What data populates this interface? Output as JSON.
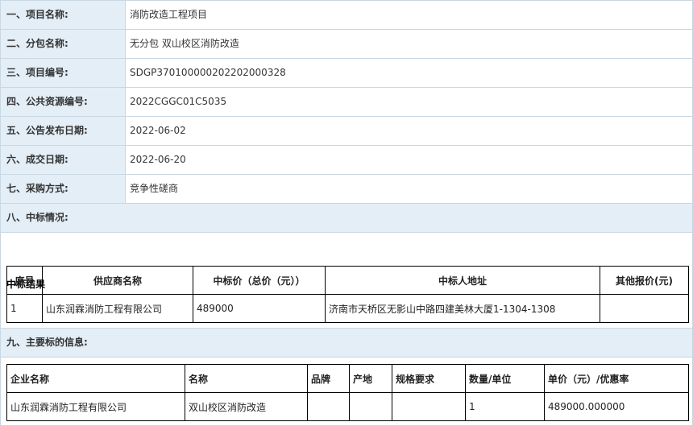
{
  "fields": [
    {
      "label": "一、项目名称:",
      "value": "消防改造工程项目"
    },
    {
      "label": "二、分包名称:",
      "value": "无分包 双山校区消防改造"
    },
    {
      "label": "三、项目编号:",
      "value": "SDGP370100000202202000328"
    },
    {
      "label": "四、公共资源编号:",
      "value": "2022CGGC01C5035"
    },
    {
      "label": "五、公告发布日期:",
      "value": "2022-06-02"
    },
    {
      "label": "六、成交日期:",
      "value": "2022-06-20"
    },
    {
      "label": "七、采购方式:",
      "value": "竞争性磋商"
    }
  ],
  "section8": {
    "label": "八、中标情况:",
    "subtitle": "中标结果",
    "headers": [
      "序号",
      "供应商名称",
      "中标价（总价（元））",
      "中标人地址",
      "其他报价(元)"
    ],
    "rows": [
      [
        "1",
        "山东润霖消防工程有限公司",
        "489000",
        "济南市天桥区无影山中路四建美林大厦1-1304-1308",
        ""
      ]
    ]
  },
  "section9": {
    "label": "九、主要标的信息:",
    "headers": [
      "企业名称",
      "名称",
      "品牌",
      "产地",
      "规格要求",
      "数量/单位",
      "单价（元）/优惠率"
    ],
    "rows": [
      [
        "山东润霖消防工程有限公司",
        "双山校区消防改造",
        "",
        "",
        "",
        "1",
        "489000.000000"
      ]
    ]
  }
}
